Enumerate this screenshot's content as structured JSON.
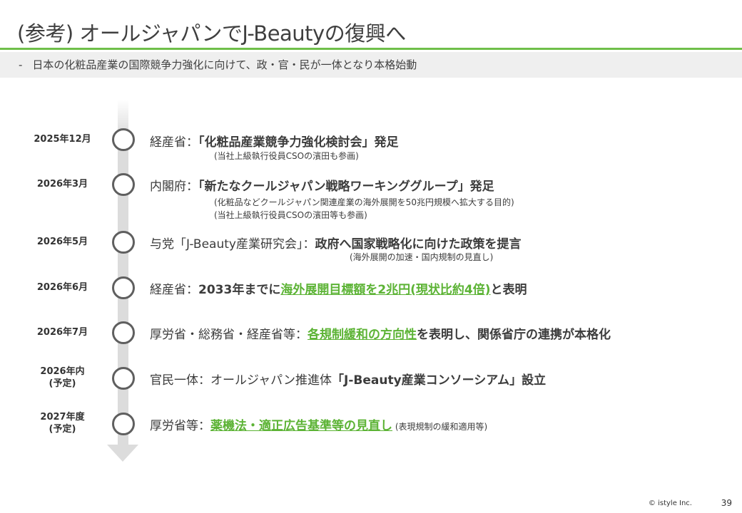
{
  "header": {
    "title": "(参考) オールジャパンでJ-Beautyの復興へ",
    "subtitle_dash": "-",
    "subtitle": "日本の化粧品産業の国際競争力強化に向けて、政・官・民が一体となり本格始動"
  },
  "timeline": [
    {
      "date_line1": "2025年12月",
      "date_line2": "",
      "org": "経産省：",
      "main": "「化粧品産業競争力強化検討会」発足",
      "notes": [
        "(当社上級執行役員CSOの濱田も参画)"
      ]
    },
    {
      "date_line1": "2026年3月",
      "date_line2": "",
      "org": "内閣府：",
      "main": "「新たなクールジャパン戦略ワーキンググループ」発足",
      "notes": [
        "(化粧品などクールジャパン関連産業の海外展開を50兆円規模へ拡大する目的)",
        "(当社上級執行役員CSOの濱田等も参画)"
      ]
    },
    {
      "date_line1": "2026年5月",
      "date_line2": "",
      "org": "与党「J-Beauty産業研究会」：",
      "main": "政府へ国家戦略化に向けた政策を提言",
      "notes": [
        "(海外展開の加速・国内規制の見直し)"
      ]
    },
    {
      "date_line1": "2026年6月",
      "date_line2": "",
      "org": "経産省：",
      "pre": "2033年までに",
      "highlight": "海外展開目標額を2兆円(現状比約4倍)",
      "post": "と表明"
    },
    {
      "date_line1": "2026年7月",
      "date_line2": "",
      "org": "厚労省・総務省・経産省等：",
      "highlight": "各規制緩和の方向性",
      "post": "を表明し、関係省庁の連携が本格化"
    },
    {
      "date_line1": "2026年内",
      "date_line2": "(予定)",
      "org": "官民一体：オールジャパン推進体",
      "main": "「J-Beauty産業コンソーシアム」設立"
    },
    {
      "date_line1": "2027年度",
      "date_line2": "(予定)",
      "org": "厚労省等：",
      "highlight": "薬機法・適正広告基準等の見直し",
      "small": " (表現規制の緩和適用等)"
    }
  ],
  "footer": {
    "copyright": "© istyle Inc.",
    "page": "39"
  },
  "colors": {
    "accent_green": "#5cb335",
    "rule_green": "#6fbf4a",
    "timeline_gray": "#dcdcdc",
    "node_border": "#5f5f5f"
  }
}
